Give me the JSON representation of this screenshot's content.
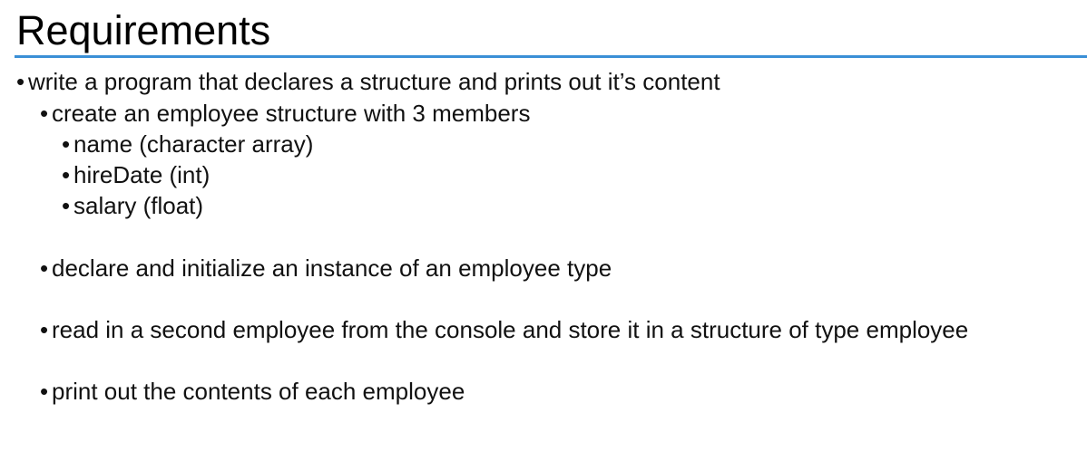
{
  "slide": {
    "title": "Requirements",
    "rule_color": "#3a8fd6",
    "bullets": [
      {
        "level": 1,
        "text": "write a program that declares a structure and prints out it’s content"
      },
      {
        "level": 2,
        "text": "create an employee structure with 3 members"
      },
      {
        "level": 3,
        "text": "name (character array)"
      },
      {
        "level": 3,
        "text": "hireDate (int)"
      },
      {
        "level": 3,
        "text": "salary (float)"
      },
      {
        "level": 2,
        "text": "declare and initialize an instance of an employee type"
      },
      {
        "level": 2,
        "text": "read in a second employee from the console and store it in a structure of type employee"
      },
      {
        "level": 2,
        "text": "print out the contents of each employee"
      }
    ]
  }
}
